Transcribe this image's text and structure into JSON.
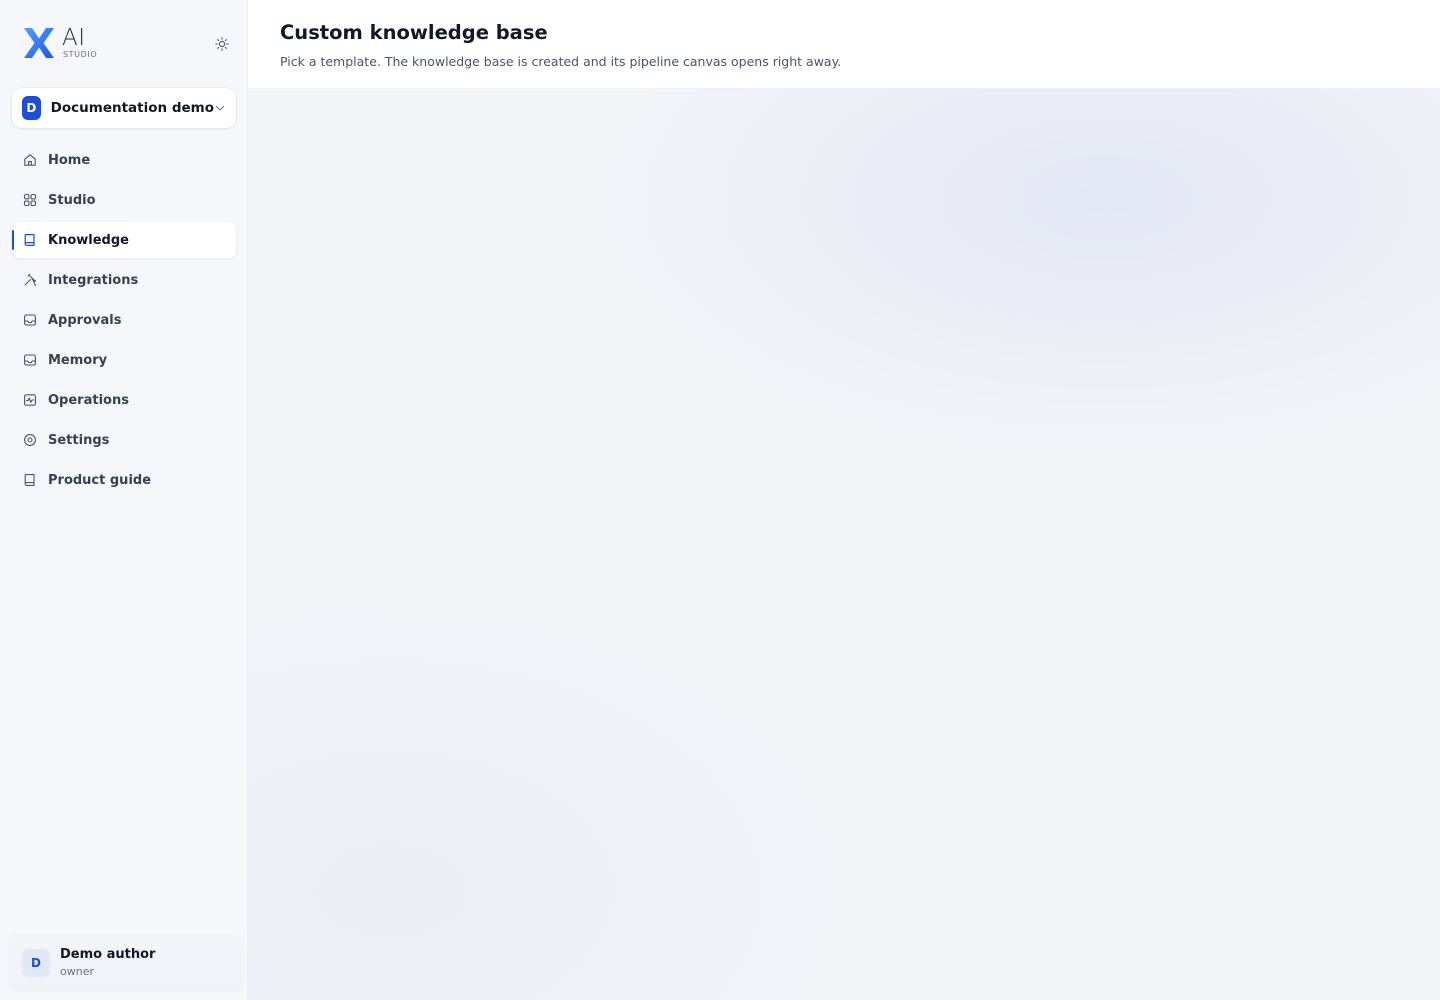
{
  "brand": {
    "logo_mark": "X",
    "logo_text": "AI",
    "logo_subtext": "STUDIO"
  },
  "header_controls": {
    "theme_icon": "sun-icon"
  },
  "workspace": {
    "initial": "D",
    "name": "Documentation demo",
    "chevron_icon": "chevron-down-icon"
  },
  "sidebar": {
    "items": [
      {
        "label": "Home",
        "icon": "home-icon",
        "active": false
      },
      {
        "label": "Studio",
        "icon": "grid-icon",
        "active": false
      },
      {
        "label": "Knowledge",
        "icon": "book-icon",
        "active": true
      },
      {
        "label": "Integrations",
        "icon": "tools-icon",
        "active": false
      },
      {
        "label": "Approvals",
        "icon": "inbox-icon",
        "active": false
      },
      {
        "label": "Memory",
        "icon": "inbox-icon",
        "active": false
      },
      {
        "label": "Operations",
        "icon": "activity-icon",
        "active": false
      },
      {
        "label": "Settings",
        "icon": "gear-icon",
        "active": false
      },
      {
        "label": "Product guide",
        "icon": "book-icon",
        "active": false
      }
    ]
  },
  "user": {
    "initial": "D",
    "name": "Demo author",
    "role": "owner"
  },
  "page": {
    "title": "Custom knowledge base",
    "subtitle": "Pick a template. The knowledge base is created and its pipeline canvas opens right away."
  },
  "colors": {
    "accent": "#1d4ed8",
    "sidebar_bg": "#f6f7fb",
    "canvas_bg": "#f3f4f8"
  }
}
